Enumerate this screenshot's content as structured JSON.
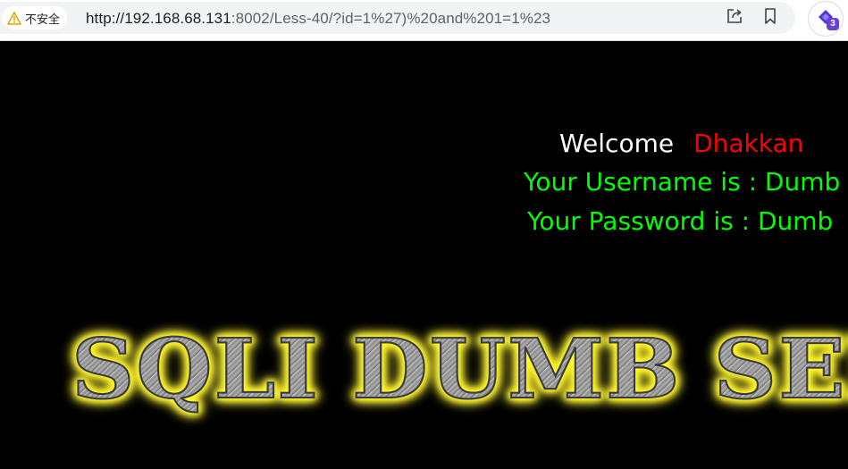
{
  "browser": {
    "security_label": "不安全",
    "url_host": "http://192.168.68.131",
    "url_rest": ":8002/Less-40/?id=1%27)%20and%201=1%23",
    "extension_badge": "3",
    "icons": [
      "warning-icon",
      "share-icon",
      "bookmark-icon",
      "extension-icon"
    ]
  },
  "page": {
    "welcome_label": "Welcome",
    "welcome_name": "Dhakkan",
    "username_line": "Your Username is : Dumb",
    "password_line": "Your Password is : Dumb",
    "banner_text": "SQLI DUMB SERIES"
  },
  "colors": {
    "background": "#000000",
    "welcome": "#ffffff",
    "name": "#ff0000",
    "credentials": "#00ff00",
    "banner_glow": "#ffff33"
  }
}
